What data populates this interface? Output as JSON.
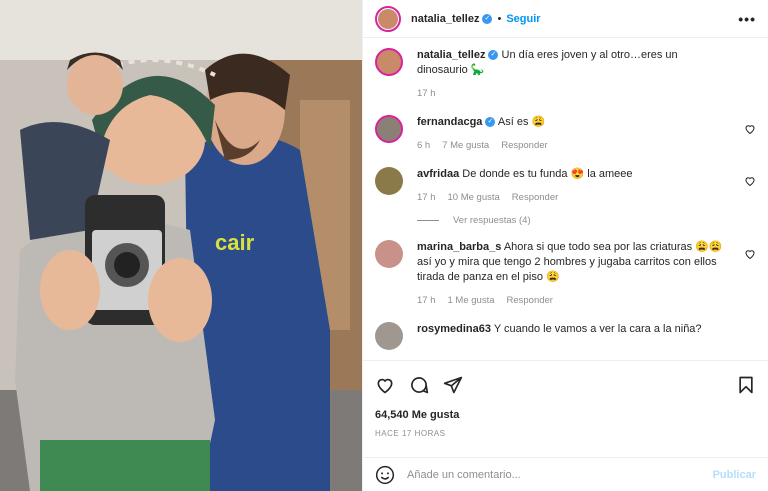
{
  "post": {
    "author": "natalia_tellez",
    "follow_label": "Seguir",
    "separator": "•",
    "more_label": "•••",
    "caption_author": "natalia_tellez",
    "caption": "Un día eres joven y al otro…eres un dinosaurio 🦕",
    "caption_time": "17 h"
  },
  "comments": [
    {
      "user": "fernandacga",
      "verified": true,
      "text": "Así es 😩",
      "time": "6 h",
      "likes": "7 Me gusta",
      "reply": "Responder"
    },
    {
      "user": "avfridaa",
      "verified": false,
      "text": "De donde es tu funda 😍 la ameee",
      "time": "17 h",
      "likes": "10 Me gusta",
      "reply": "Responder",
      "view_replies": "Ver respuestas (4)"
    },
    {
      "user": "marina_barba_s",
      "verified": false,
      "text": "Ahora si que todo sea por las criaturas 😩😩 así yo y mira que tengo 2 hombres y jugaba carritos con ellos tirada de panza en el piso 😩",
      "time": "17 h",
      "likes": "1 Me gusta",
      "reply": "Responder"
    },
    {
      "user": "rosymedina63",
      "verified": false,
      "text": "Y cuando le vamos a ver la cara a la niña?",
      "time": "",
      "likes": "",
      "reply": ""
    }
  ],
  "footer": {
    "likes": "64,540 Me gusta",
    "timestamp": "HACE 17 HORAS",
    "comment_placeholder": "Añade un comentario...",
    "publish_label": "Publicar"
  },
  "icons": {
    "verified": "verified-badge-icon",
    "heart": "heart-icon",
    "comment": "comment-icon",
    "share": "share-icon",
    "save": "bookmark-icon",
    "emoji": "emoji-icon"
  },
  "colors": {
    "link": "#0095f6",
    "verified": "#3897f0",
    "muted": "#8e8e8e",
    "publish_disabled": "#b2dffc"
  }
}
